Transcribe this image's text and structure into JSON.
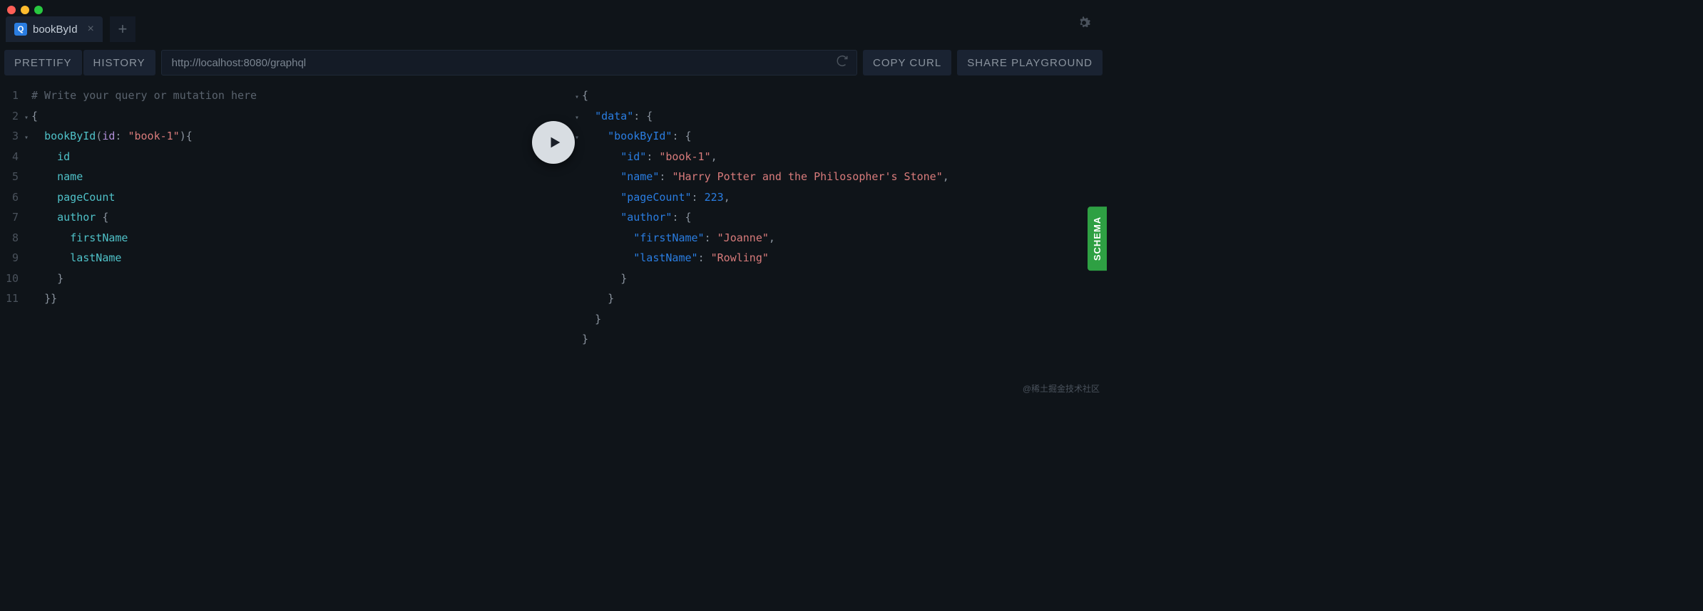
{
  "tab": {
    "icon_letter": "Q",
    "label": "bookById"
  },
  "toolbar": {
    "prettify": "PRETTIFY",
    "history": "HISTORY",
    "url": "http://localhost:8080/graphql",
    "copy_curl": "COPY CURL",
    "share": "SHARE PLAYGROUND"
  },
  "editor": {
    "lines": [
      {
        "n": "1",
        "html": "<span class='comment'># Write your query or mutation here</span>"
      },
      {
        "n": "2",
        "fold": "▾",
        "html": "<span class='punct'>{</span>"
      },
      {
        "n": "3",
        "fold": "▾",
        "html": "  <span class='kw'>bookById</span><span class='punct'>(</span><span class='arg'>id</span><span class='punct'>: </span><span class='str'>\"book-1\"</span><span class='punct'>){</span>"
      },
      {
        "n": "4",
        "html": "    <span class='field'>id</span>"
      },
      {
        "n": "5",
        "html": "    <span class='field'>name</span>"
      },
      {
        "n": "6",
        "html": "    <span class='field'>pageCount</span>"
      },
      {
        "n": "7",
        "html": "    <span class='field'>author</span> <span class='punct'>{</span>"
      },
      {
        "n": "8",
        "html": "      <span class='field'>firstName</span>"
      },
      {
        "n": "9",
        "html": "      <span class='field'>lastName</span>"
      },
      {
        "n": "10",
        "html": "    <span class='punct'>}</span>"
      },
      {
        "n": "11",
        "html": "  <span class='punct'>}}</span>"
      }
    ]
  },
  "result": {
    "lines": [
      {
        "fold": "▾",
        "html": "<span class='jpunct'>{</span>"
      },
      {
        "fold": "▾",
        "html": "  <span class='jkey'>\"data\"</span><span class='jpunct'>: {</span>"
      },
      {
        "fold": "▾",
        "html": "    <span class='jkey'>\"bookById\"</span><span class='jpunct'>: {</span>"
      },
      {
        "html": "      <span class='jkey'>\"id\"</span><span class='jpunct'>: </span><span class='jstr'>\"book-1\"</span><span class='jpunct'>,</span>"
      },
      {
        "html": "      <span class='jkey'>\"name\"</span><span class='jpunct'>: </span><span class='jstr'>\"Harry Potter and the Philosopher's Stone\"</span><span class='jpunct'>,</span>"
      },
      {
        "html": "      <span class='jkey'>\"pageCount\"</span><span class='jpunct'>: </span><span class='jnum'>223</span><span class='jpunct'>,</span>"
      },
      {
        "html": "      <span class='jkey'>\"author\"</span><span class='jpunct'>: {</span>"
      },
      {
        "html": "        <span class='jkey'>\"firstName\"</span><span class='jpunct'>: </span><span class='jstr'>\"Joanne\"</span><span class='jpunct'>,</span>"
      },
      {
        "html": "        <span class='jkey'>\"lastName\"</span><span class='jpunct'>: </span><span class='jstr'>\"Rowling\"</span>"
      },
      {
        "html": "      <span class='jpunct'>}</span>"
      },
      {
        "html": "    <span class='jpunct'>}</span>"
      },
      {
        "html": "  <span class='jpunct'>}</span>"
      },
      {
        "html": "<span class='jpunct'>}</span>"
      }
    ]
  },
  "schema_label": "SCHEMA",
  "watermark": "@稀土掘金技术社区"
}
